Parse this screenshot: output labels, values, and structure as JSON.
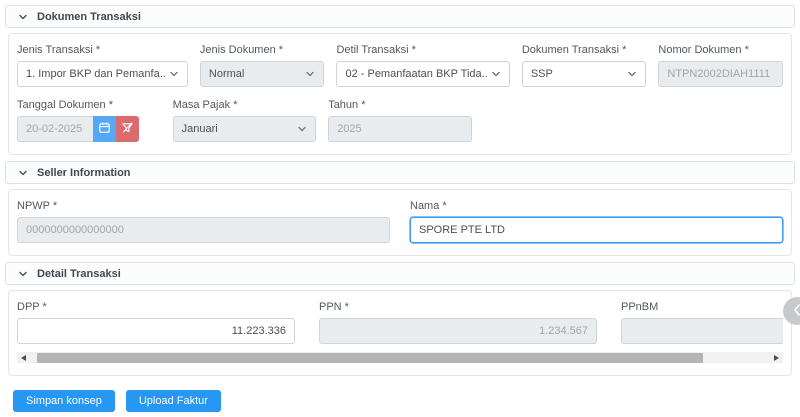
{
  "colors": {
    "accent_blue": "#2797f4",
    "calendar_button_blue": "#55a8f3",
    "clear_button_red": "#dd6a6d",
    "disabled_bg": "#e9ecef",
    "focus_border": "#3f9bf5"
  },
  "panels": {
    "dokumen_transaksi": {
      "title": "Dokumen Transaksi",
      "jenis_transaksi": {
        "label": "Jenis Transaksi *",
        "value": "1. Impor BKP dan Pemanfa..."
      },
      "jenis_dokumen": {
        "label": "Jenis Dokumen *",
        "value": "Normal"
      },
      "detil_transaksi": {
        "label": "Detil Transaksi *",
        "value": "02 - Pemanfaatan BKP Tida..."
      },
      "dokumen_transaksi": {
        "label": "Dokumen Transaksi *",
        "value": "SSP"
      },
      "nomor_dokumen": {
        "label": "Nomor Dokumen *",
        "value": "NTPN2002DIAH1111"
      },
      "tanggal_dokumen": {
        "label": "Tanggal Dokumen *",
        "value": "20-02-2025"
      },
      "masa_pajak": {
        "label": "Masa Pajak *",
        "value": "Januari"
      },
      "tahun": {
        "label": "Tahun *",
        "value": "2025"
      }
    },
    "seller_information": {
      "title": "Seller Information",
      "npwp": {
        "label": "NPWP *",
        "value": "0000000000000000"
      },
      "nama": {
        "label": "Nama *",
        "value": "SPORE PTE LTD"
      }
    },
    "detail_transaksi": {
      "title": "Detail Transaksi",
      "dpp": {
        "label": "DPP *",
        "value": "11.223.336"
      },
      "ppn": {
        "label": "PPN *",
        "value": "1.234.567"
      },
      "ppnbm": {
        "label": "PPnBM",
        "value": ""
      }
    }
  },
  "actions": {
    "simpan_konsep": "Simpan konsep",
    "upload_faktur": "Upload Faktur"
  },
  "icons": {
    "section_toggle": "chevron-down-icon",
    "dropdown": "chevron-down-icon",
    "date_picker": "calendar-icon",
    "date_clear": "filter-slash-icon",
    "scroll_prev": "triangle-left-icon",
    "scroll_next": "triangle-right-icon",
    "side_overlay": "chevron-left-icon"
  }
}
